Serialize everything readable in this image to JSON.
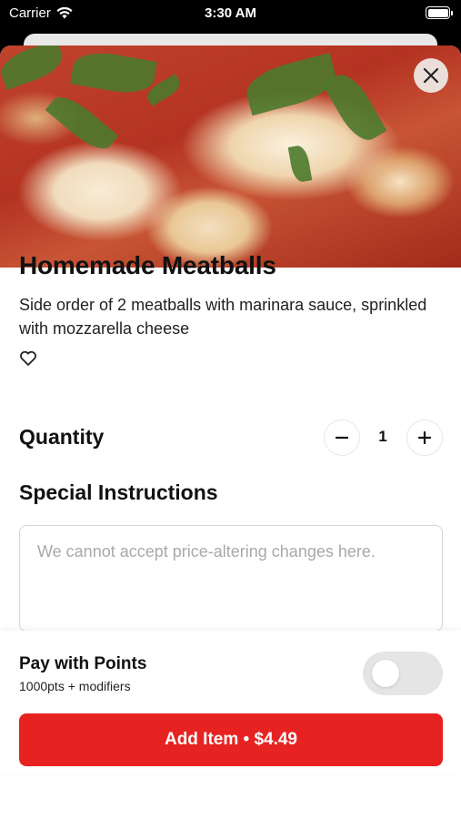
{
  "status_bar": {
    "carrier": "Carrier",
    "time": "3:30 AM"
  },
  "item": {
    "title": "Homemade Meatballs",
    "description": "Side order of 2 meatballs with marinara sauce, sprinkled with mozzarella cheese"
  },
  "quantity": {
    "label": "Quantity",
    "value": "1"
  },
  "special_instructions": {
    "label": "Special Instructions",
    "placeholder": "We cannot accept price-altering changes here.",
    "value": ""
  },
  "points": {
    "title": "Pay with Points",
    "subtitle": "1000pts + modifiers",
    "enabled": false
  },
  "add_button": {
    "label": "Add Item • $4.49"
  },
  "colors": {
    "accent": "#e62321",
    "toggle_off": "#e5e5e5"
  }
}
